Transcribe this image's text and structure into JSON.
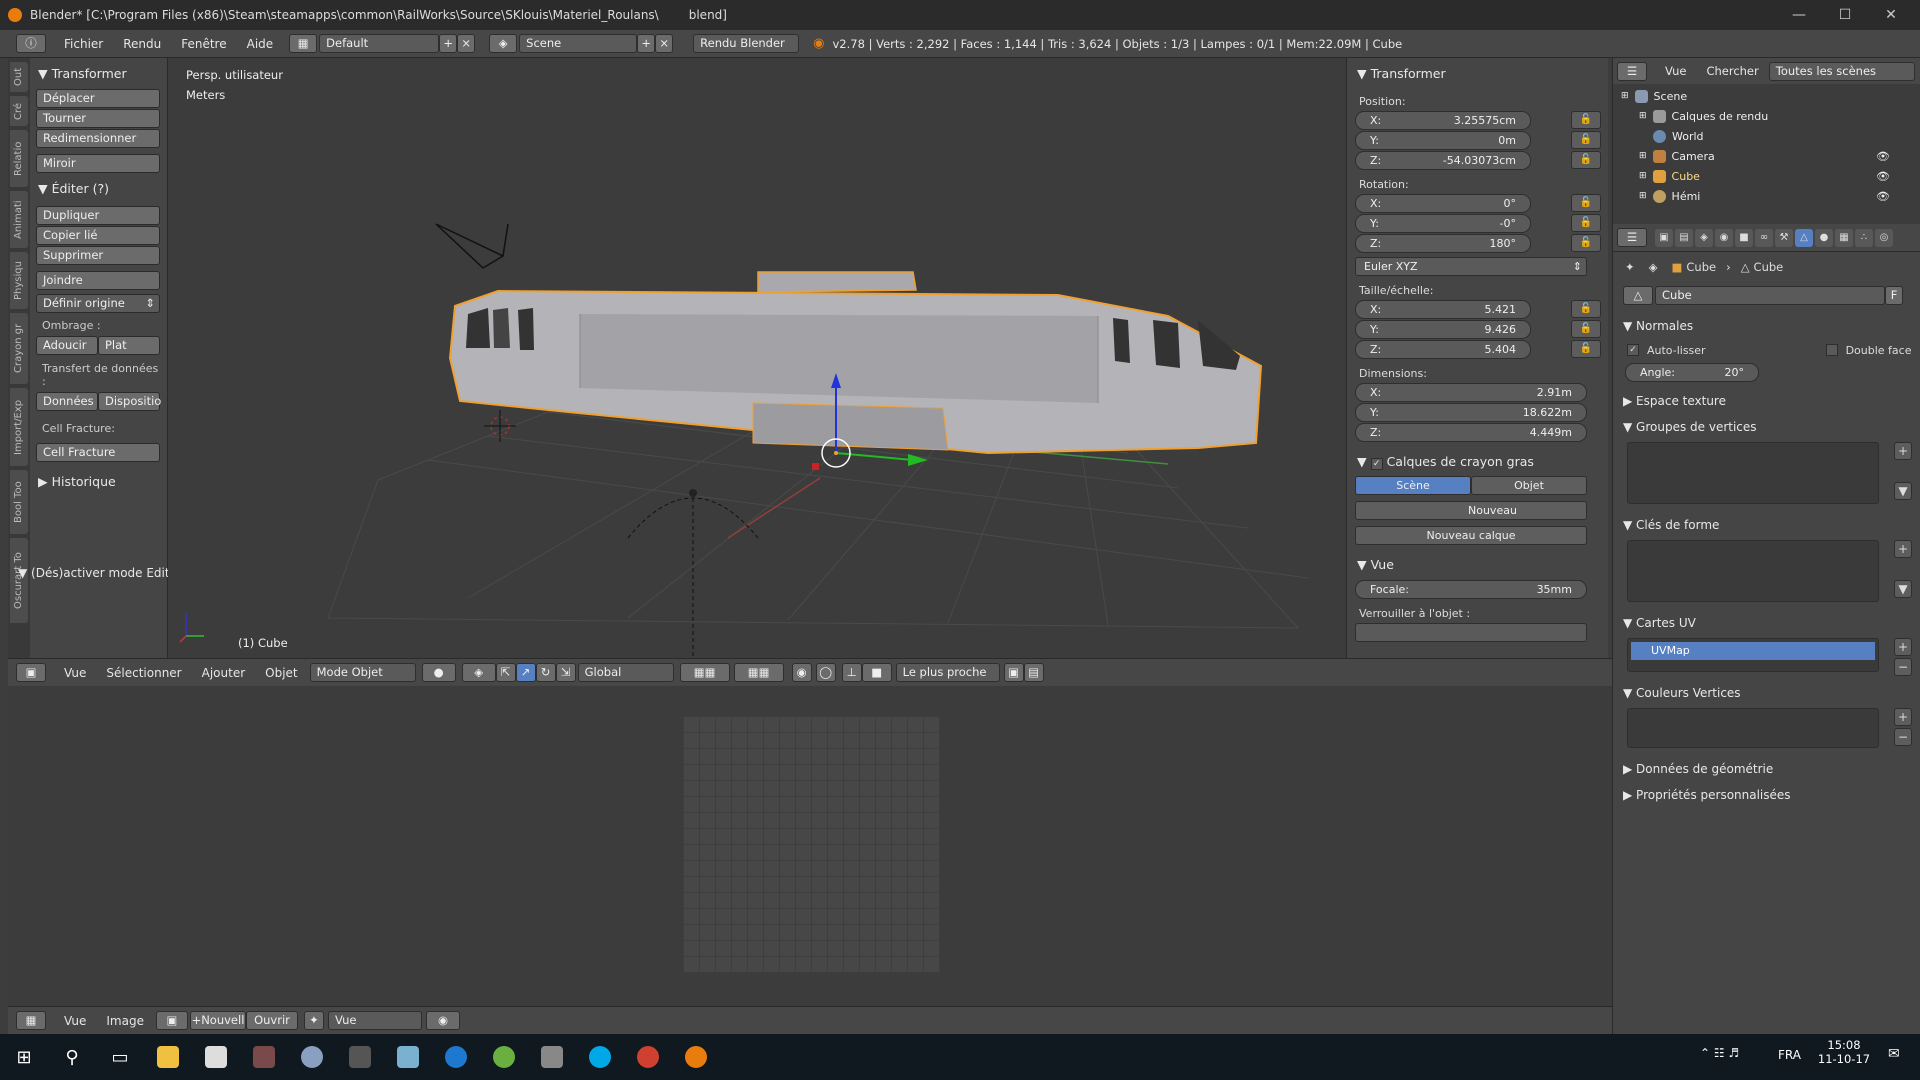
{
  "window": {
    "title": "Blender* [C:\\Program Files (x86)\\Steam\\steamapps\\common\\RailWorks\\Source\\SKlouis\\Materiel_Roulans\\",
    "title_tail": "blend]"
  },
  "info": {
    "menus": [
      "Fichier",
      "Rendu",
      "Fenêtre",
      "Aide"
    ],
    "layout": "Default",
    "scene": "Scene",
    "engine": "Rendu Blender",
    "stats": "v2.78 | Verts : 2,292 | Faces : 1,144 | Tris : 3,624 | Objets : 1/3 | Lampes : 0/1 | Mem:22.09M | Cube"
  },
  "shelf_tabs": [
    "Out",
    "Cré",
    "Relatio",
    "Animati",
    "Physiqu",
    "Crayon gr",
    "Import/Exp",
    "Bool Too",
    "Oscurart To"
  ],
  "toolshelf": {
    "transformer": "Transformer",
    "transform_buttons": [
      "Déplacer",
      "Tourner",
      "Redimensionner"
    ],
    "miroir": "Miroir",
    "editer": "Éditer (?)",
    "edit_buttons": [
      "Dupliquer",
      "Copier lié",
      "Supprimer"
    ],
    "joindre": "Joindre",
    "origin": "Définir origine",
    "ombrage": "Ombrage :",
    "adoucir": "Adoucir",
    "plat": "Plat",
    "transfert": "Transfert de données :",
    "donnees": "Données",
    "dispositio": "Dispositio",
    "cellfrac_label": "Cell Fracture:",
    "cellfrac_btn": "Cell Fracture",
    "historique": "Historique",
    "operator": "(Dés)activer mode Edit"
  },
  "viewport": {
    "view_name": "Persp. utilisateur",
    "units": "Meters",
    "object_label": "(1) Cube"
  },
  "npanel": {
    "transformer": "Transformer",
    "position_label": "Position:",
    "position": [
      {
        "k": "X:",
        "v": "3.25575cm"
      },
      {
        "k": "Y:",
        "v": "0m"
      },
      {
        "k": "Z:",
        "v": "-54.03073cm"
      }
    ],
    "rotation_label": "Rotation:",
    "rotation": [
      {
        "k": "X:",
        "v": "0°"
      },
      {
        "k": "Y:",
        "v": "-0°"
      },
      {
        "k": "Z:",
        "v": "180°"
      }
    ],
    "rot_mode": "Euler XYZ",
    "scale_label": "Taille/échelle:",
    "scale": [
      {
        "k": "X:",
        "v": "5.421"
      },
      {
        "k": "Y:",
        "v": "9.426"
      },
      {
        "k": "Z:",
        "v": "5.404"
      }
    ],
    "dims_label": "Dimensions:",
    "dims": [
      {
        "k": "X:",
        "v": "2.91m"
      },
      {
        "k": "Y:",
        "v": "18.622m"
      },
      {
        "k": "Z:",
        "v": "4.449m"
      }
    ],
    "gp_title": "Calques de crayon gras",
    "gp_scene": "Scène",
    "gp_objet": "Objet",
    "gp_nouveau": "Nouveau",
    "gp_nouveau_calque": "Nouveau calque",
    "vue_title": "Vue",
    "focale_k": "Focale:",
    "focale_v": "35mm",
    "lock_label": "Verrouiller à l'objet :"
  },
  "vphead": {
    "menus": [
      "Vue",
      "Sélectionner",
      "Ajouter",
      "Objet"
    ],
    "mode": "Mode Objet",
    "orientation": "Global",
    "snap": "Le plus proche"
  },
  "uvhead": {
    "menus": [
      "Vue",
      "Image"
    ],
    "new": "Nouvell",
    "open": "Ouvrir",
    "view": "Vue"
  },
  "outliner": {
    "menus": [
      "Vue",
      "Chercher"
    ],
    "filter": "Toutes les scènes",
    "rows": [
      "Scene",
      "Calques de rendu",
      "World",
      "Camera",
      "Cube",
      "Hémi"
    ]
  },
  "props": {
    "breadcrumb1": "Cube",
    "breadcrumb2": "Cube",
    "mesh_name": "Cube",
    "fake_user": "F",
    "normales": "Normales",
    "autolisser": "Auto-lisser",
    "double_face": "Double face",
    "angle_k": "Angle:",
    "angle_v": "20°",
    "espace_texture": "Espace texture",
    "groupes": "Groupes de vertices",
    "cles": "Clés de forme",
    "cartes_uv": "Cartes UV",
    "uvmap": "UVMap",
    "couleurs": "Couleurs Vertices",
    "geometrie": "Données de géométrie",
    "perso": "Propriétés personnalisées"
  },
  "taskbar": {
    "lang": "FRA",
    "time": "15:08",
    "date": "11-10-17"
  },
  "colors": {
    "accent_blue": "#5680c2",
    "selection_orange": "#f0a030",
    "blender_orange": "#e87d0d"
  }
}
